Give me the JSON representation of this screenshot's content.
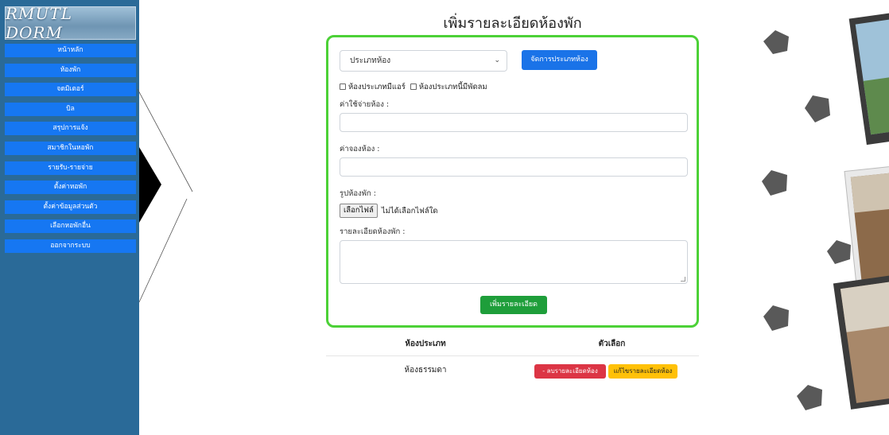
{
  "sidebar": {
    "logo_text": "RMUTL DORM",
    "items": [
      {
        "label": "หน้าหลัก"
      },
      {
        "label": "ห้องพัก"
      },
      {
        "label": "จดมิเตอร์"
      },
      {
        "label": "บิล"
      },
      {
        "label": "สรุปการแจ้ง"
      },
      {
        "label": "สมาชิกในหอพัก"
      },
      {
        "label": "รายรับ-รายจ่าย"
      },
      {
        "label": "ตั้งค่าหอพัก"
      },
      {
        "label": "ตั้งค่าข้อมูลส่วนตัว"
      },
      {
        "label": "เลือกหอพักอื่น"
      },
      {
        "label": "ออกจากระบบ"
      }
    ]
  },
  "page_title": "เพิ่มรายละเอียดห้องพัก",
  "form": {
    "room_type_select": {
      "value": "ประเภทห้อง"
    },
    "manage_type_button": "จัดการประเภทห้อง",
    "checkbox_aircon": "ห้องประเภทมีแอร์",
    "checkbox_fan": "ห้องประเภทนี้มีพัดลม",
    "rent_label": "ค่าใช้จ่ายห้อง :",
    "deposit_label": "ค่าจองห้อง :",
    "image_label": "รูปห้องพัก :",
    "file_button": "เลือกไฟล์",
    "file_status": "ไม่ได้เลือกไฟล์ใด",
    "detail_label": "รายละเอียดห้องพัก :",
    "submit_button": "เพิ่มรายละเอียด"
  },
  "table": {
    "headers": [
      "ห้องประเภท",
      "ตัวเลือก"
    ],
    "rows": [
      {
        "type": "ห้องธรรมดา",
        "delete_label": "- ลบรายละเอียดห้อง",
        "edit_label": "แก้ไขรายละเอียดห้อง"
      }
    ]
  },
  "colors": {
    "sidebar_bg": "#2a6a98",
    "menu_item": "#1677f2",
    "card_border": "#4cd137",
    "primary": "#1a73e8",
    "success": "#1e9e3a",
    "danger": "#dc3545",
    "warning": "#ffc107"
  }
}
